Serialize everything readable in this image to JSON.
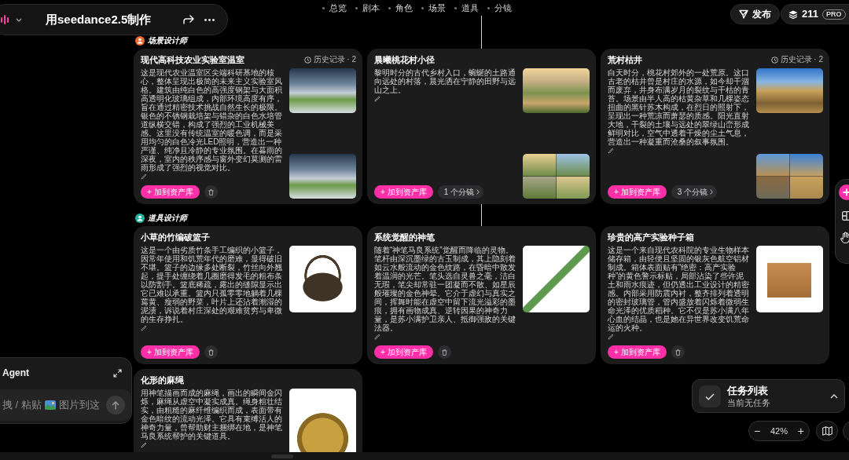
{
  "toolbar": {
    "title": "用seedance2.5制作"
  },
  "nav": [
    "总览",
    "剧本",
    "角色",
    "场景",
    "道具",
    "分镜"
  ],
  "publish": "发布",
  "credits": {
    "count": "211",
    "plan": "PRO"
  },
  "sections": [
    {
      "label": "场景设计师",
      "color": "#f06a2e",
      "cards": [
        {
          "title": "现代高科技农业实验室温室",
          "history": "历史记录 · 2",
          "description": "这是现代农业温室区尖端科研基地的核心，整体呈现出极简的未来主义实验室风格。建筑由纯白色的高强度钢架与大面积高透明化玻璃组成，内部环境高度有序，旨在通过精密技术挑战自然生长的极限。银色的不锈钢栽培架与错杂的白色水培管道纵横交错，构成了强烈的工业机械美感。这里没有传统温室的暖色调，而是采用均匀的白色冷光LED照明，营造出一种严谨、纯净且冷静的专业氛围。在暮雨的深夜，室内的秩序感与窗外变幻莫测的雷雨形成了强烈的视觉对比。",
          "images": [
            {
              "kind": "photo"
            },
            {
              "kind": "photo"
            }
          ],
          "add_button": "+ 加到资产库"
        },
        {
          "title": "晨曦桃花村小径",
          "description": "黎明时分的古代乡村入口，蜿蜒的土路通向远处的村落，晨光洒在宁静的田野与远山之上。",
          "images": [
            {
              "kind": "photo"
            },
            {
              "kind": "collage"
            }
          ],
          "add_button": "+ 加到资产库",
          "shots": "1 个分镜"
        },
        {
          "title": "荒村枯井",
          "history": "历史记录 · 2",
          "description": "白天时分，桃花村郊外的一处荒原。这口古老的枯井曾是村庄的水源，如今却干涸而废弃，井身布满岁月的裂纹与干枯的青苔。场景由半人高的枯黄杂草和几棵姿态扭曲的黑针苏木构成，在烈日的照射下，呈现出一种荒凉而萧瑟的质感。阳光直射大地，干裂的土壤与远处的翠绿山峦形成鲜明对比，空气中透着干燥的尘土气息，营造出一种凝重而沧桑的叙事氛围。",
          "images": [
            {
              "kind": "photo"
            },
            {
              "kind": "collage"
            }
          ],
          "add_button": "+ 加到资产库",
          "shots": "3 个分镜"
        }
      ]
    },
    {
      "label": "道具设计师",
      "color": "#22b3a3",
      "cards": [
        {
          "title": "小草的竹编破篮子",
          "description": "这是一个由劣质竹条手工编织的小篮子，因常年使用和饥荒年代的磨难，显得破旧不堪。篮子的边缘多处断裂，竹丝向外翘起，提手处缠绕着几圈磨得发毛的粗布条以防割手。篮底稀疏，露出的缝隙显示出它已难以承重。篮内只孤零零地躺着几棵蔫黄、瘦弱的野菜，叶片上还沾着潮湿的泥渍，诉说着村庄深处的艰难贫穷与卑微的生存挣扎。",
          "images": [
            {
              "kind": "product"
            }
          ],
          "add_button": "+ 加到资产库"
        },
        {
          "title": "系统觉醒的神笔",
          "description": "随着“神笔马良系统”觉醒而降临的灵物。笔杆由深沉墨绿的古玉制成，其上隐刻着如云水般流动的金色纹路，在昏暗中散发着温润的光芒。笔头选自灵兽之毫，洁白无瑕，笔尖却常驻一团凝而不散、如星辰般璀璨的金色神晕。它介于虚幻与真实之间，挥舞时能在虚空中留下流光溢彩的墨痕，拥有画物成真、逆转因果的神奇力量，是苏小满护卫亲人、抵御强敌的关键法器。",
          "images": [
            {
              "kind": "product"
            }
          ],
          "add_button": "+ 加到资产库"
        },
        {
          "title": "珍贵的高产实验种子箱",
          "description": "这是一个来自现代农科院的专业生物样本储存箱，由轻便且坚固的银灰色航空铝材制成。箱体表面贴有“绝密：高产实验种”的黄色警示标贴，局部沾染了些许泥土和雨水痕迹，但仍透出工业设计的精密感。内部采用防震内衬，整齐排列着透明的密封玻璃管，管内盛放着闪烁着微弱生命光泽的优质稻种。它不仅是苏小满八年心血的结晶，也是她在异世界改变饥荒命运的火种。",
          "images": [
            {
              "kind": "product"
            }
          ],
          "add_button": "+ 加到资产库"
        },
        {
          "title": "化形的麻绳",
          "description": "用神笔描画而成的麻绳，画出的瞬间金闪烁，麻绳从虚空中凝实成真。绳身粗壮结实，由粗糙的麻纤维编织而成，表面带有金色暗纹的流动光泽。它具有束缚活人的神奇力量，曾帮助财主捆绑在地，是神笔马良系统帮护的关键道具。",
          "images": [
            {
              "kind": "product"
            }
          ]
        }
      ]
    }
  ],
  "agent": {
    "title": "Agent",
    "hint_before": "拽 / 粘贴",
    "hint_after": "图片到这"
  },
  "tasks": {
    "title": "任务列表",
    "status": "当前无任务"
  },
  "zoom": {
    "out": "−",
    "level": "42%",
    "in": "+"
  }
}
